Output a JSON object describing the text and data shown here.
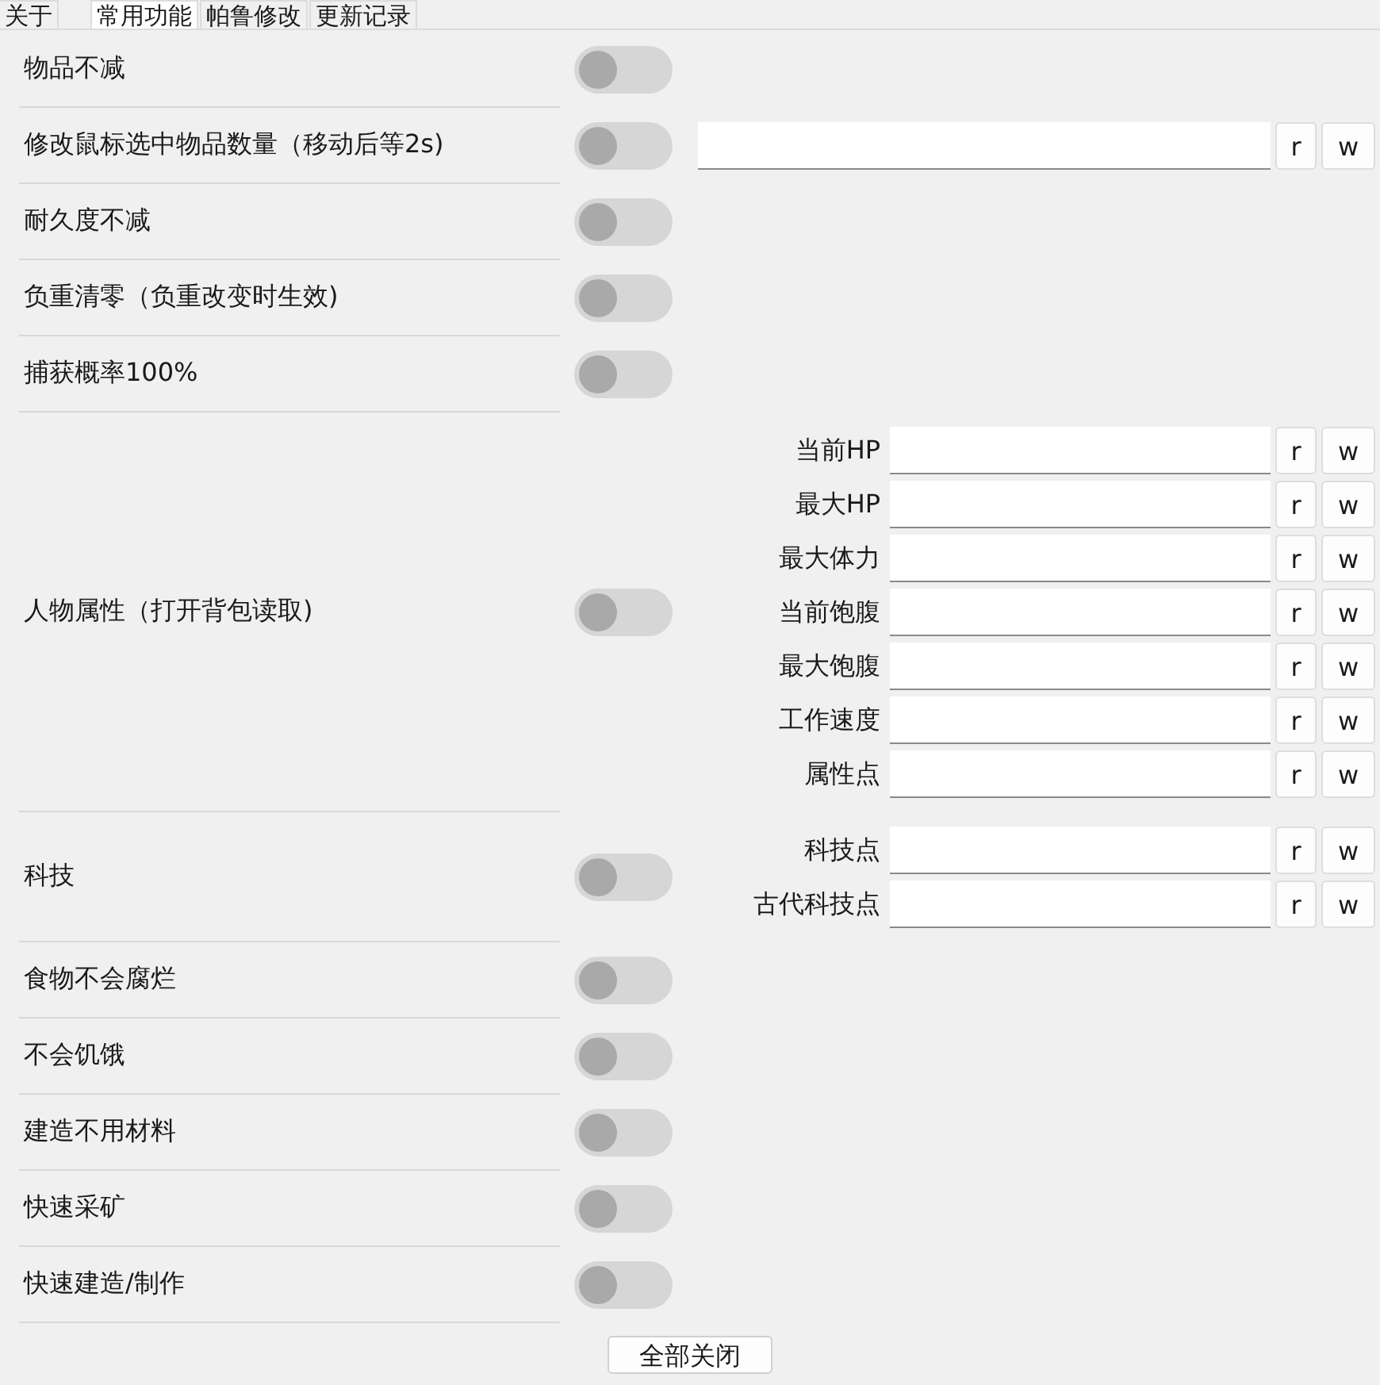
{
  "tabs": [
    {
      "label": "关于",
      "selected": false
    },
    {
      "label": "常用功能",
      "selected": true
    },
    {
      "label": "帕鲁修改",
      "selected": false
    },
    {
      "label": "更新记录",
      "selected": false
    }
  ],
  "features": [
    {
      "label": "物品不减",
      "on": false
    },
    {
      "label": "修改鼠标选中物品数量（移动后等2s)",
      "on": false,
      "fields": [
        {
          "read": "r",
          "write": "w"
        }
      ]
    },
    {
      "label": "耐久度不减",
      "on": false
    },
    {
      "label": "负重清零（负重改变时生效)",
      "on": false
    },
    {
      "label": "捕获概率100%",
      "on": false
    },
    {
      "label": "人物属性（打开背包读取)",
      "on": false,
      "fields": [
        {
          "label": "当前HP",
          "read": "r",
          "write": "w"
        },
        {
          "label": "最大HP",
          "read": "r",
          "write": "w"
        },
        {
          "label": "最大体力",
          "read": "r",
          "write": "w"
        },
        {
          "label": "当前饱腹",
          "read": "r",
          "write": "w"
        },
        {
          "label": "最大饱腹",
          "read": "r",
          "write": "w"
        },
        {
          "label": "工作速度",
          "read": "r",
          "write": "w"
        },
        {
          "label": "属性点",
          "read": "r",
          "write": "w"
        }
      ]
    },
    {
      "label": "科技",
      "on": false,
      "fields": [
        {
          "label": "科技点",
          "read": "r",
          "write": "w"
        },
        {
          "label": "古代科技点",
          "read": "r",
          "write": "w"
        }
      ]
    },
    {
      "label": "食物不会腐烂",
      "on": false
    },
    {
      "label": "不会饥饿",
      "on": false
    },
    {
      "label": "建造不用材料",
      "on": false
    },
    {
      "label": "快速采矿",
      "on": false
    },
    {
      "label": "快速建造/制作",
      "on": false
    }
  ],
  "close_all_button": "全部关闭"
}
